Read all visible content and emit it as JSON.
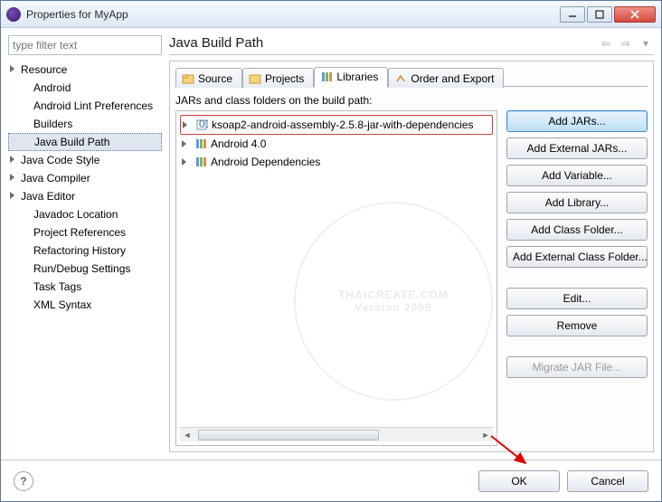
{
  "window": {
    "title": "Properties for MyApp"
  },
  "filter": {
    "placeholder": "type filter text"
  },
  "tree": {
    "items": [
      {
        "label": "Resource",
        "expandable": true
      },
      {
        "label": "Android"
      },
      {
        "label": "Android Lint Preferences"
      },
      {
        "label": "Builders"
      },
      {
        "label": "Java Build Path",
        "selected": true
      },
      {
        "label": "Java Code Style",
        "expandable": true
      },
      {
        "label": "Java Compiler",
        "expandable": true
      },
      {
        "label": "Java Editor",
        "expandable": true
      },
      {
        "label": "Javadoc Location"
      },
      {
        "label": "Project References"
      },
      {
        "label": "Refactoring History"
      },
      {
        "label": "Run/Debug Settings"
      },
      {
        "label": "Task Tags"
      },
      {
        "label": "XML Syntax"
      }
    ]
  },
  "page": {
    "heading": "Java Build Path",
    "tabs": {
      "source": "Source",
      "projects": "Projects",
      "libraries": "Libraries",
      "order": "Order and Export"
    },
    "pane_label": "JARs and class folders on the build path:",
    "entries": {
      "jar": "ksoap2-android-assembly-2.5.8-jar-with-dependencies",
      "android": "Android 4.0",
      "deps": "Android Dependencies"
    },
    "buttons": {
      "add_jars": "Add JARs...",
      "add_external_jars": "Add External JARs...",
      "add_variable": "Add Variable...",
      "add_library": "Add Library...",
      "add_class_folder": "Add Class Folder...",
      "add_external_class_folder": "Add External Class Folder...",
      "edit": "Edit...",
      "remove": "Remove",
      "migrate": "Migrate JAR File..."
    }
  },
  "footer": {
    "ok": "OK",
    "cancel": "Cancel"
  },
  "watermark": {
    "line1": "THAICREATE.COM",
    "line2": "Version 2009"
  }
}
